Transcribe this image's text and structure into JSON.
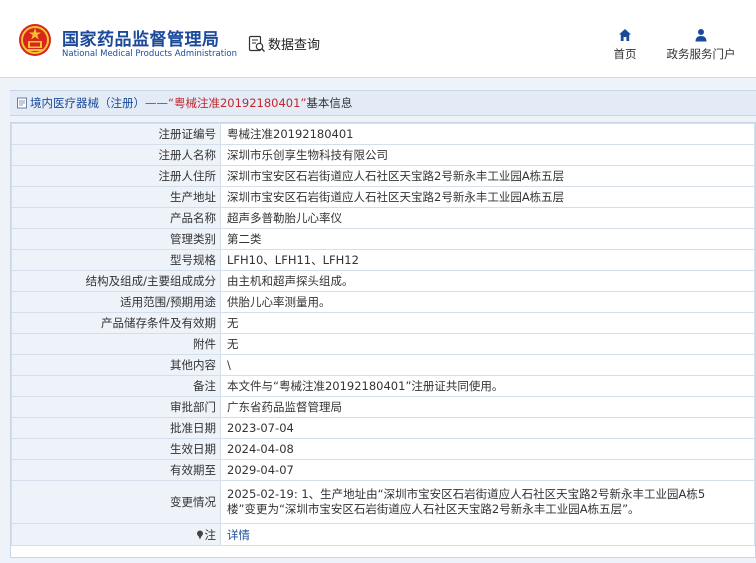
{
  "header": {
    "brand_cn": "国家药品监督管理局",
    "brand_en": "National Medical Products Administration",
    "data_query": "数据查询",
    "nav": [
      {
        "label": "首页",
        "icon": "home-icon"
      },
      {
        "label": "政务服务门户",
        "icon": "user-icon"
      }
    ]
  },
  "breadcrumb": {
    "category": "境内医疗器械（注册）",
    "separator": "——",
    "record_title": "“粤械注准20192180401”",
    "suffix": "基本信息"
  },
  "details": [
    {
      "label": "注册证编号",
      "value": "粤械注准20192180401"
    },
    {
      "label": "注册人名称",
      "value": "深圳市乐创享生物科技有限公司"
    },
    {
      "label": "注册人住所",
      "value": "深圳市宝安区石岩街道应人石社区天宝路2号新永丰工业园A栋五层"
    },
    {
      "label": "生产地址",
      "value": "深圳市宝安区石岩街道应人石社区天宝路2号新永丰工业园A栋五层"
    },
    {
      "label": "产品名称",
      "value": "超声多普勒胎儿心率仪"
    },
    {
      "label": "管理类别",
      "value": "第二类"
    },
    {
      "label": "型号规格",
      "value": "LFH10、LFH11、LFH12"
    },
    {
      "label": "结构及组成/主要组成成分",
      "value": "由主机和超声探头组成。"
    },
    {
      "label": "适用范围/预期用途",
      "value": "供胎儿心率测量用。"
    },
    {
      "label": "产品储存条件及有效期",
      "value": "无"
    },
    {
      "label": "附件",
      "value": "无"
    },
    {
      "label": "其他内容",
      "value": "\\"
    },
    {
      "label": "备注",
      "value": "本文件与“粤械注准20192180401”注册证共同使用。"
    },
    {
      "label": "审批部门",
      "value": "广东省药品监督管理局"
    },
    {
      "label": "批准日期",
      "value": "2023-07-04"
    },
    {
      "label": "生效日期",
      "value": "2024-04-08"
    },
    {
      "label": "有效期至",
      "value": "2029-04-07"
    }
  ],
  "change": {
    "label": "变更情况",
    "line1": "2025-02-19: 1、生产地址由“深圳市宝安区石岩街道应人石社区天宝路2号新永丰工业园A栋5",
    "line2": "楼”变更为“深圳市宝安区石岩街道应人石社区天宝路2号新永丰工业园A栋五层”。"
  },
  "note": {
    "label": "注",
    "link": "详情"
  },
  "colors": {
    "brand_blue": "#1b4a9a",
    "title_red": "#c3262c",
    "label_bg": "#eef3fa",
    "border": "#d5dfec"
  }
}
